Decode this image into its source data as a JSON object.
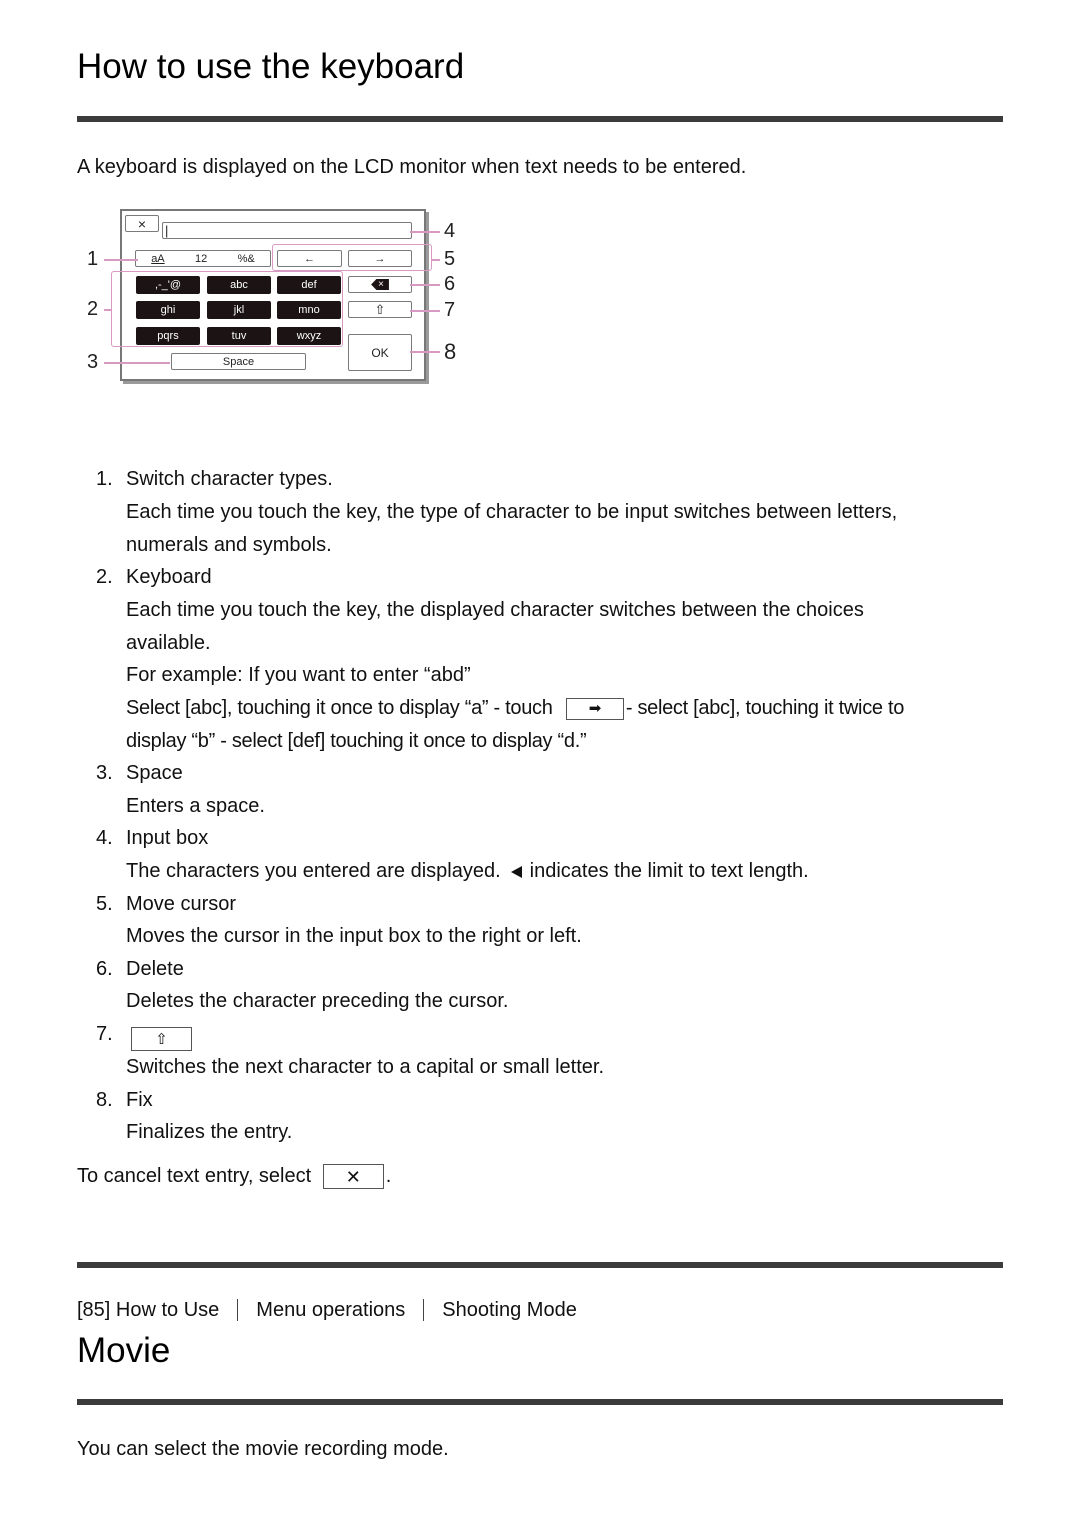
{
  "section1": {
    "title": "How to use the keyboard",
    "intro": "A keyboard is displayed on the LCD monitor when text needs to be entered.",
    "diagram": {
      "close_key": "×",
      "input_cursor": "|",
      "char_type_labels": [
        "aA",
        "12",
        "%&"
      ],
      "cursor_left": "←",
      "cursor_right": "→",
      "keys": [
        ",-_'@",
        "abc",
        "def",
        "ghi",
        "jkl",
        "mno",
        "pqrs",
        "tuv",
        "wxyz"
      ],
      "delete_key": "×",
      "shift_key": "⇧",
      "ok_key": "OK",
      "space_key": "Space",
      "callouts": [
        "1",
        "2",
        "3",
        "4",
        "5",
        "6",
        "7",
        "8"
      ]
    },
    "items": [
      {
        "num": "1.",
        "title": "Switch character types.",
        "desc": [
          "Each time you touch the key, the type of character to be input switches between letters,",
          "numerals and symbols."
        ]
      },
      {
        "num": "2.",
        "title": "Keyboard",
        "desc": [
          "Each time you touch the key, the displayed character switches between the choices",
          "available.",
          "For example: If you want to enter “abd”"
        ],
        "example_a": "Select [abc], touching it once to display “a” - touch",
        "example_b": "- select [abc], touching it twice to",
        "example_c": "display “b” - select [def] touching it once to display “d.”"
      },
      {
        "num": "3.",
        "title": "Space",
        "desc": [
          "Enters a space."
        ]
      },
      {
        "num": "4.",
        "title": "Input box",
        "desc_a": "The characters you entered are displayed.",
        "desc_b": "indicates the limit to text length."
      },
      {
        "num": "5.",
        "title": "Move cursor",
        "desc": [
          "Moves the cursor in the input box to the right or left."
        ]
      },
      {
        "num": "6.",
        "title": "Delete",
        "desc": [
          "Deletes the character preceding the cursor."
        ]
      },
      {
        "num": "7.",
        "icon": "⇧",
        "desc": [
          "Switches the next character to a capital or small letter."
        ]
      },
      {
        "num": "8.",
        "title": "Fix",
        "desc": [
          "Finalizes the entry."
        ]
      }
    ],
    "cancel_text": "To cancel text entry, select",
    "cancel_icon": "✕",
    "cancel_period": ".",
    "arrow_icon": "➡"
  },
  "section2": {
    "breadcrumb": [
      "[85] How to Use",
      "Menu operations",
      "Shooting Mode"
    ],
    "title": "Movie",
    "intro": "You can select the movie recording mode."
  }
}
